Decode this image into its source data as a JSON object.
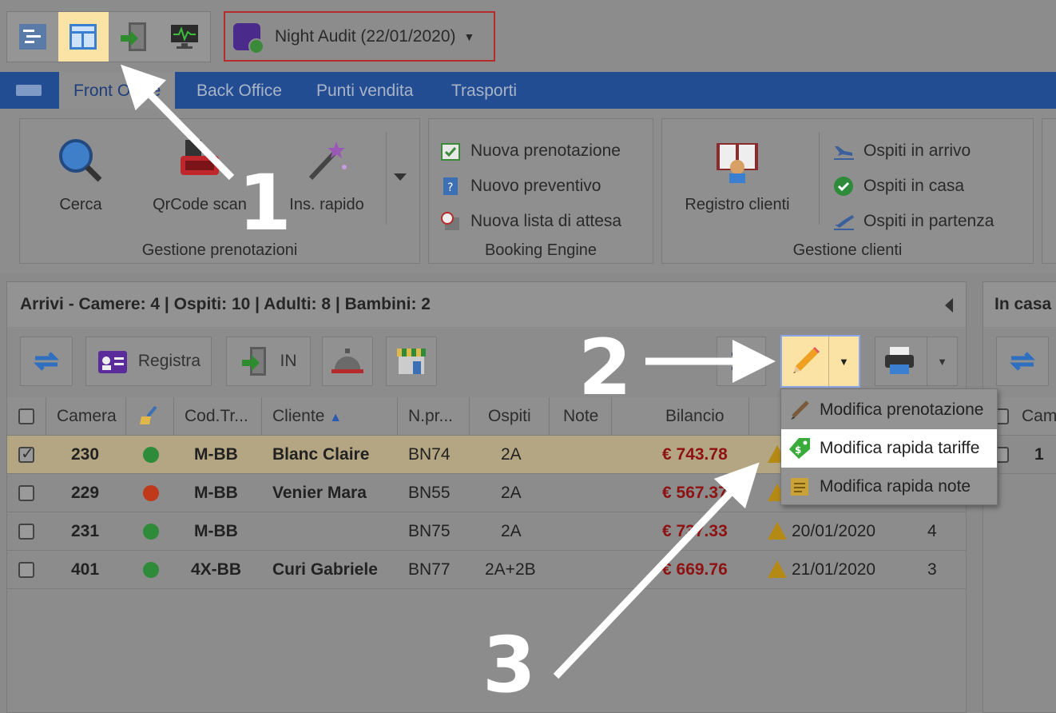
{
  "audit": {
    "label": "Night Audit (22/01/2020)"
  },
  "tabs": [
    "Front Office",
    "Back Office",
    "Punti vendita",
    "Trasporti"
  ],
  "ribbon": {
    "group1": {
      "label": "Gestione prenotazioni",
      "buttons": [
        "Cerca",
        "QrCode scan",
        "Ins. rapido"
      ]
    },
    "group2": {
      "label": "Booking Engine",
      "items": [
        "Nuova prenotazione",
        "Nuovo preventivo",
        "Nuova lista di attesa"
      ]
    },
    "group3": {
      "label": "Gestione clienti",
      "button": "Registro clienti",
      "items": [
        "Ospiti in arrivo",
        "Ospiti in casa",
        "Ospiti in partenza"
      ]
    }
  },
  "panel": {
    "title": "Arrivi - Camere: 4 | Ospiti: 10 | Adulti: 8 | Bambini: 2",
    "toolbar": {
      "registra": "Registra",
      "in": "IN"
    },
    "columns": [
      "Camera",
      "Cod.Tr...",
      "Cliente",
      "N.pr...",
      "Ospiti",
      "Note",
      "Bilancio"
    ],
    "rows": [
      {
        "camera": "230",
        "status": "green",
        "cod": "M-BB",
        "cliente": "Blanc Claire",
        "npr": "BN74",
        "ospiti": "2A",
        "bilancio": "€ 743.78",
        "date": "",
        "extra": ""
      },
      {
        "camera": "229",
        "status": "red",
        "cod": "M-BB",
        "cliente": "Venier Mara",
        "npr": "BN55",
        "ospiti": "2A",
        "bilancio": "€ 567.37",
        "date": "",
        "extra": ""
      },
      {
        "camera": "231",
        "status": "green",
        "cod": "M-BB",
        "cliente": "",
        "npr": "BN75",
        "ospiti": "2A",
        "bilancio": "€ 737.33",
        "date": "20/01/2020",
        "extra": "4"
      },
      {
        "camera": "401",
        "status": "green",
        "cod": "4X-BB",
        "cliente": "Curi Gabriele",
        "npr": "BN77",
        "ospiti": "2A+2B",
        "bilancio": "€ 669.76",
        "date": "21/01/2020",
        "extra": "3"
      }
    ]
  },
  "right_panel": {
    "title": "In casa",
    "col": "Cam",
    "row_val": "1"
  },
  "menu": [
    "Modifica prenotazione",
    "Modifica rapida tariffe",
    "Modifica rapida note"
  ],
  "annotations": [
    "1",
    "2",
    "3"
  ]
}
